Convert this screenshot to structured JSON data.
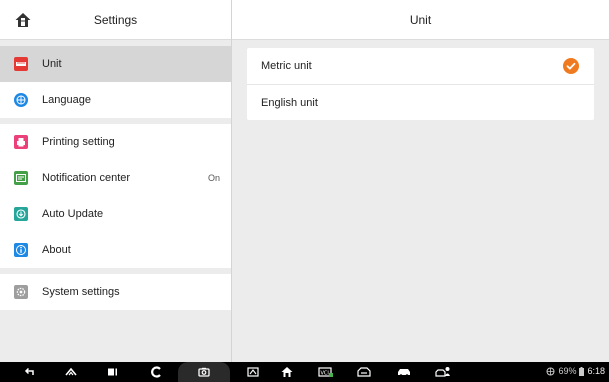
{
  "left_header": {
    "title": "Settings"
  },
  "right_header": {
    "title": "Unit"
  },
  "menu": [
    {
      "label": "Unit",
      "icon": "ruler-icon",
      "color": "#e53935",
      "selected": true
    },
    {
      "label": "Language",
      "icon": "globe-icon",
      "color": "#1e88e5"
    },
    {
      "label": "Printing setting",
      "icon": "printer-icon",
      "color": "#ec407a"
    },
    {
      "label": "Notification center",
      "icon": "notification-icon",
      "color": "#43a047",
      "value": "On"
    },
    {
      "label": "Auto Update",
      "icon": "update-icon",
      "color": "#26a69a"
    },
    {
      "label": "About",
      "icon": "info-icon",
      "color": "#1e88e5"
    },
    {
      "label": "System settings",
      "icon": "gear-icon",
      "color": "#9e9e9e"
    }
  ],
  "units": [
    {
      "label": "Metric unit",
      "checked": true
    },
    {
      "label": "English unit",
      "checked": false
    }
  ],
  "status": {
    "battery": "69%",
    "time": "6:18"
  },
  "accent_color": "#f07a1f"
}
